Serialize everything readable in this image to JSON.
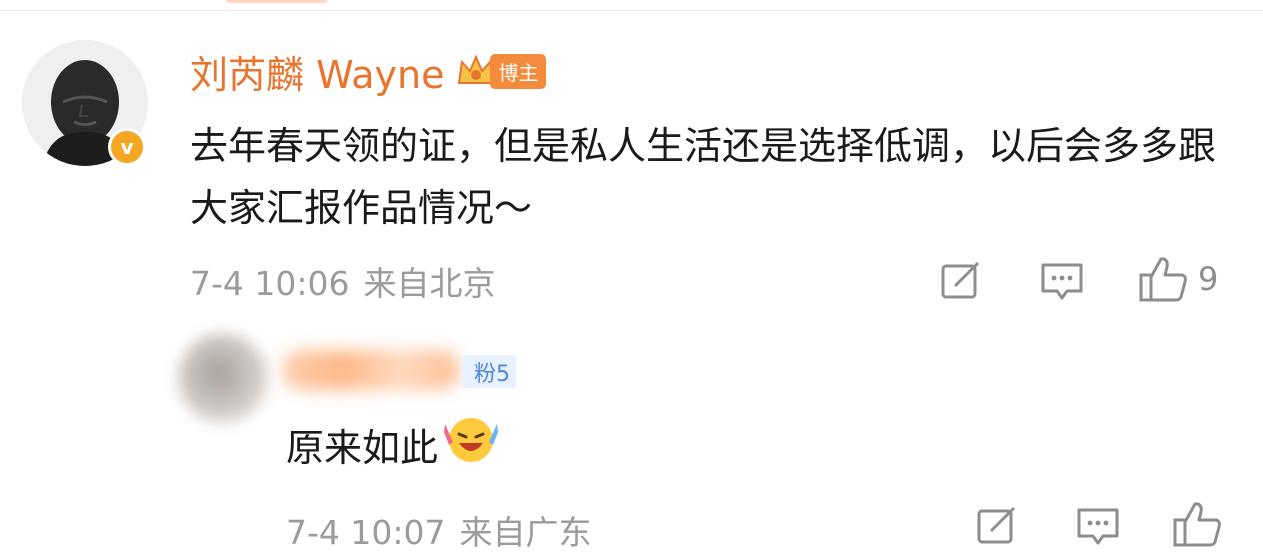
{
  "comment1": {
    "username": "刘芮麟 Wayne",
    "role_badge": "博主",
    "verified_icon": "v-badge-icon",
    "text": "去年春天领的证，但是私人生活还是选择低调，以后会多多跟大家汇报作品情况～",
    "time": "7-4 10:06",
    "source": "来自北京",
    "like_count": "9"
  },
  "comment2": {
    "fan_badge": "粉5",
    "text": "原来如此",
    "emoji_icon": "laughing-tears-emoji-icon",
    "time": "7-4 10:07",
    "source": "来自广东"
  },
  "colors": {
    "username": "#e8742d",
    "badge": "#f48a3b",
    "fan_badge_bg": "#e7f1ff",
    "fan_badge_text": "#4e8ad6",
    "meta": "#9b9b9b"
  }
}
